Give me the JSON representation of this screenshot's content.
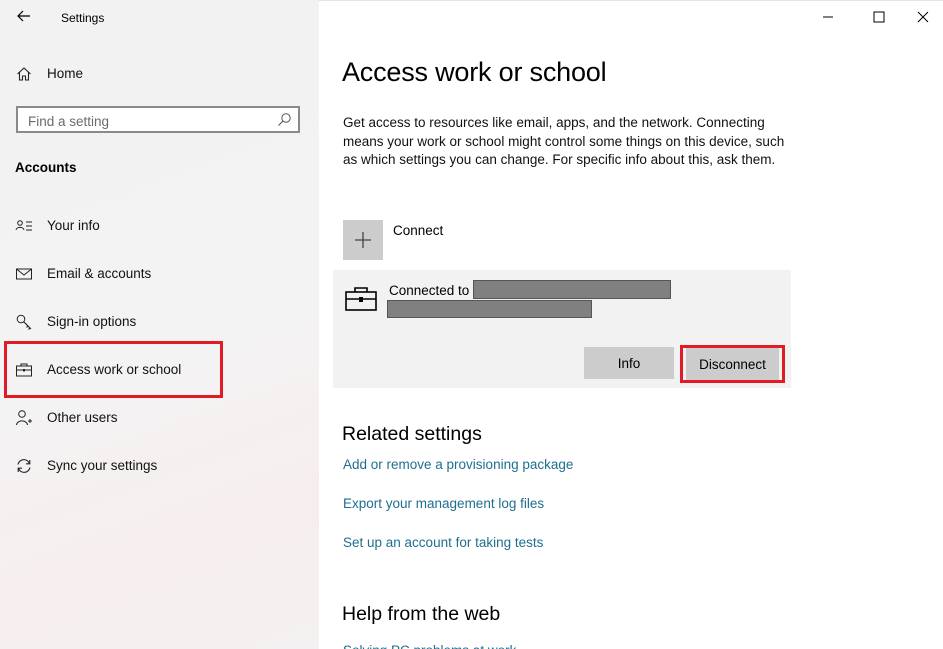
{
  "window": {
    "title": "Settings",
    "controls": [
      "minimize-icon",
      "maximize-icon",
      "close-icon"
    ]
  },
  "sidebar": {
    "home_label": "Home",
    "search": {
      "placeholder": "Find a setting",
      "value": ""
    },
    "section_title": "Accounts",
    "items": [
      {
        "label": "Your info",
        "icon": "person-card-icon"
      },
      {
        "label": "Email & accounts",
        "icon": "envelope-icon"
      },
      {
        "label": "Sign-in options",
        "icon": "key-icon"
      },
      {
        "label": "Access work or school",
        "icon": "briefcase-icon",
        "selected": true
      },
      {
        "label": "Other users",
        "icon": "person-add-icon"
      },
      {
        "label": "Sync your settings",
        "icon": "sync-icon"
      }
    ]
  },
  "main": {
    "title": "Access work or school",
    "description": "Get access to resources like email, apps, and the network. Connecting means your work or school might control some things on this device, such as which settings you can change. For specific info about this, ask them.",
    "connect_label": "Connect",
    "account": {
      "connected_prefix": "Connected to",
      "info_button": "Info",
      "disconnect_button": "Disconnect"
    },
    "related_settings": {
      "heading": "Related settings",
      "links": [
        "Add or remove a provisioning package",
        "Export your management log files",
        "Set up an account for taking tests"
      ]
    },
    "help": {
      "heading": "Help from the web",
      "partial_link": "Solving PC problems at work"
    }
  },
  "colors": {
    "accent_link": "#1f6e8f",
    "highlight_red": "#e01b24",
    "button_gray": "#cccccc",
    "redaction_gray": "#808080"
  }
}
